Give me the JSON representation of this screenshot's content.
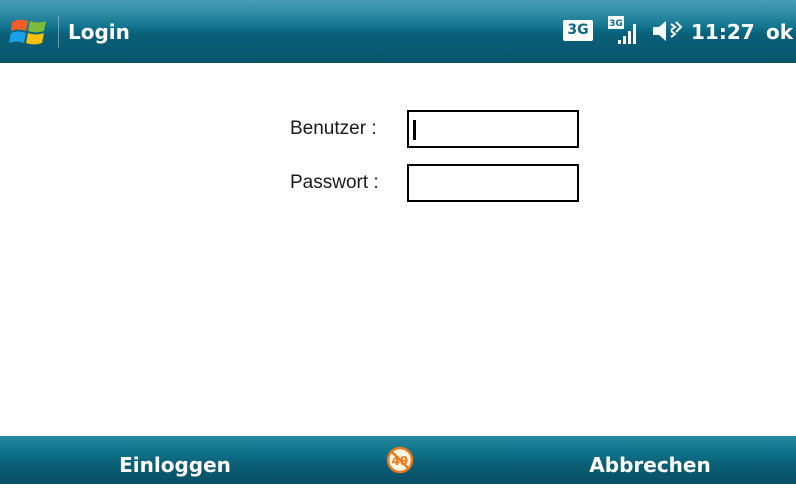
{
  "titlebar": {
    "title": "Login",
    "network_badge": "3G",
    "time": "11:27",
    "ok_label": "ok",
    "icons": [
      "windows-flag-icon",
      "signal-strength-icon",
      "speaker-icon"
    ]
  },
  "form": {
    "user_label": "Benutzer :",
    "user_value": "",
    "pass_label": "Passwort :",
    "pass_value": ""
  },
  "softkeys": {
    "left_label": "Einloggen",
    "right_label": "Abbrechen",
    "center_icon": "keyboard-sip-icon"
  },
  "colors": {
    "titlebar": "#0c6f8a",
    "bottombar": "#0d6e86",
    "text_light": "#ffffff"
  }
}
